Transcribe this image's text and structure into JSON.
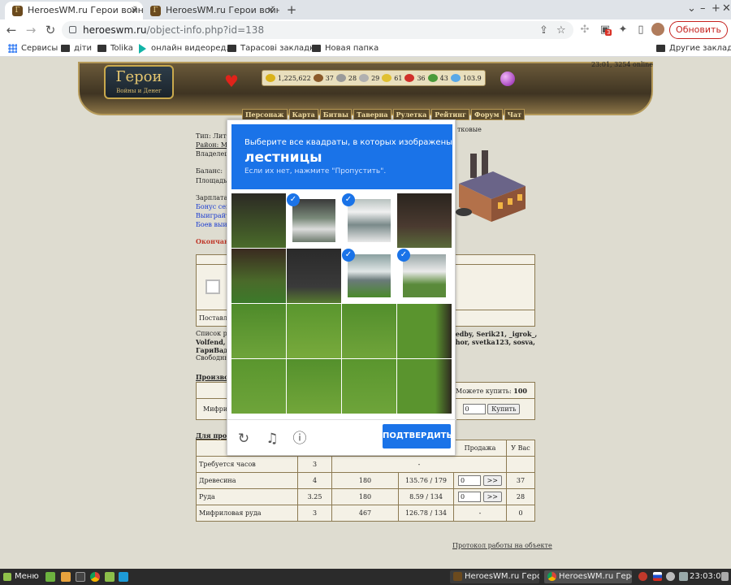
{
  "tabs": [
    {
      "title": "HeroesWM.ru Герои войны и",
      "favicon": "heroes-favicon"
    },
    {
      "title": "HeroesWM.ru Герои войны и",
      "favicon": "heroes-favicon"
    }
  ],
  "toolbar": {
    "url_host": "heroeswm.ru",
    "url_path": "/object-info.php?id=138",
    "update_label": "Обновить",
    "ext_badge": "3"
  },
  "bookmarks": [
    {
      "label": "Сервисы",
      "icon": "apps-icon"
    },
    {
      "label": "діти",
      "icon": "folder-icon"
    },
    {
      "label": "Tolika",
      "icon": "folder-icon"
    },
    {
      "label": "онлайн видеоред...",
      "icon": "play-icon"
    },
    {
      "label": "Тарасові закладки",
      "icon": "folder-icon"
    },
    {
      "label": "Новая папка",
      "icon": "folder-icon"
    }
  ],
  "other_bookmarks": "Другие закладки",
  "game": {
    "logo_title": "Герои",
    "logo_subtitle": "Войны и Денег",
    "resources": [
      "1,225,622",
      "37",
      "28",
      "29",
      "61",
      "36",
      "43",
      "103.9"
    ],
    "resource_colors": [
      "#d9b21a",
      "#8b5a2b",
      "#9a9a9a",
      "#b0b0b0",
      "#e0c030",
      "#d0302a",
      "#4a9a3a",
      "#58a8e8"
    ],
    "online_status": "23:01, 3254 online",
    "menu": [
      "Персонаж",
      "Карта",
      "Битвы",
      "Таверна",
      "Рулетка",
      "Рейтинг",
      "Форум",
      "Чат"
    ]
  },
  "object_info": {
    "type_label": "Тип: Лите",
    "type_suffix": "тковые",
    "district": "Район: Mi",
    "owner": "Владелец:",
    "balance": "Баланс:",
    "area": "Площадь:",
    "salary": "Зарплата:",
    "bonus": "Бонус сего",
    "win": "Выиграйте",
    "battles": "Боев выиг",
    "ending": "Окончан",
    "supplied": "Поставл",
    "workers_list": "Список ра",
    "workers_right": "tedby, Serik21, _igrok_,",
    "volfend": "Volfend, P",
    "workers_right2": "thor, svetka123, sosva,",
    "garivadu": "ГариВаду",
    "free": "Свободны",
    "production": "Производ",
    "can_buy_label": "Можете купить:",
    "can_buy_value": "100",
    "product_name": "Мифрил",
    "buy_qty": "0",
    "buy_button": "Купить",
    "for_production": "Для прои"
  },
  "resources_table": {
    "header_sale": "Продажа",
    "header_have": "У Вас",
    "rows": [
      {
        "name": "Требуется часов",
        "c1": "3",
        "c2": "",
        "c3": "-",
        "sale": "",
        "have": ""
      },
      {
        "name": "Древесина",
        "c1": "4",
        "c2": "180",
        "c3": "135.76 / 179",
        "sale": "0",
        "have": "37"
      },
      {
        "name": "Руда",
        "c1": "3.25",
        "c2": "180",
        "c3": "8.59 / 134",
        "sale": "0",
        "have": "28"
      },
      {
        "name": "Мифриловая руда",
        "c1": "3",
        "c2": "467",
        "c3": "126.78 / 134",
        "sale": "-",
        "have": "0"
      }
    ],
    "sell_button": ">>",
    "log_link": "Протокол работы на объекте"
  },
  "captcha": {
    "instruction": "Выберите все квадраты, в которых изображены",
    "keyword": "лестницы",
    "hint": "Если их нет, нажмите \"Пропустить\".",
    "verify_label": "ПОДТВЕРДИТЬ",
    "selected_tiles": [
      1,
      2,
      6,
      7
    ],
    "brand_color": "#1a73e8"
  },
  "taskbar": {
    "menu_label": "Меню",
    "windows": [
      "HeroesWM.ru Геро",
      "HeroesWM.ru Геро..."
    ],
    "clock": "23:03:01"
  }
}
